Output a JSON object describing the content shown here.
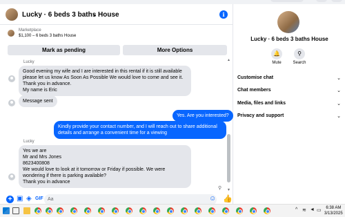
{
  "header": {
    "title": "Lucky · 6 beds 3 baths House",
    "chevron": "⌄",
    "info": "i"
  },
  "marketplace": {
    "label": "Marketplace",
    "listing": "$1,100 – 6 beds 3 baths House",
    "mark_pending": "Mark as pending",
    "more_options": "More Options"
  },
  "messages": {
    "msg1": {
      "sender": "Lucky",
      "text": "Good evening my wife and I are interested in this rental if it is still available please let us know As Soon As Possible We would love to come and see it. Thank you in advance.\nMy name is Eric"
    },
    "msg2": {
      "text": "Message sent"
    },
    "msg3": {
      "text": "Yes. Are you interested?"
    },
    "msg4": {
      "text": "Kindly provide your contact number, and I will reach out to share additional details and arrange a convenient time for a viewing"
    },
    "msg5": {
      "sender": "Lucky",
      "text": "Yes we are\nMr and Mrs Jones\n8623400808\nWe would love to look at it tomorrow or Friday if possible. We were wondering if there is parking available?\nThank you in advance"
    }
  },
  "composer": {
    "placeholder": "Aa"
  },
  "profile": {
    "name": "Lucky · 6 beds 3 baths House",
    "actions": [
      {
        "label": "Mute",
        "icon": "bell-icon"
      },
      {
        "label": "Search",
        "icon": "search-icon"
      }
    ],
    "sections": [
      "Customise chat",
      "Chat members",
      "Media, files and links",
      "Privacy and support"
    ]
  },
  "taskbar": {
    "time": "6:38 AM",
    "date": "3/13/2025"
  },
  "colors": {
    "accent": "#0866ff",
    "bubble_in": "#e4e6eb",
    "text": "#050505",
    "muted": "#65676b"
  }
}
